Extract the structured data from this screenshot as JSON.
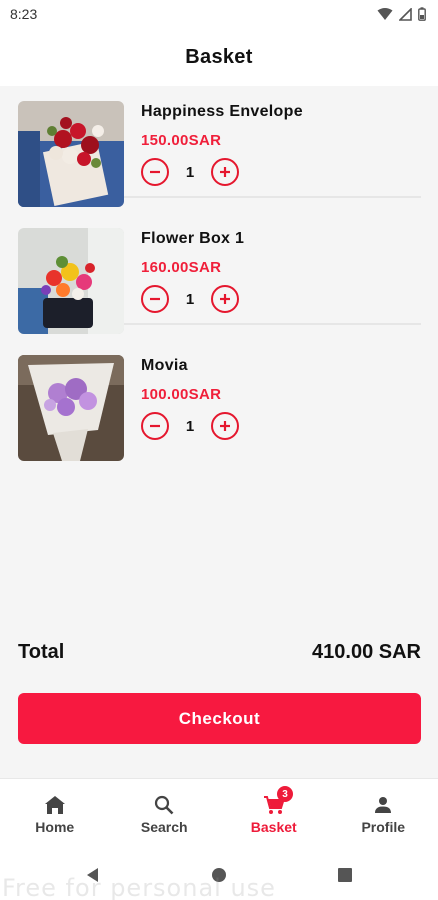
{
  "status_bar": {
    "time": "8:23",
    "icons": [
      "wifi-icon",
      "signal-icon",
      "battery-icon"
    ]
  },
  "header": {
    "title": "Basket"
  },
  "basket": {
    "items": [
      {
        "name": "Happiness Envelope",
        "price": "150.00SAR",
        "quantity": "1",
        "image": "red-white-roses-envelope"
      },
      {
        "name": "Flower Box 1",
        "price": "160.00SAR",
        "quantity": "1",
        "image": "colorful-flower-box"
      },
      {
        "name": "Movia",
        "price": "100.00SAR",
        "quantity": "1",
        "image": "purple-bouquet"
      }
    ]
  },
  "summary": {
    "total_label": "Total",
    "total_value": "410.00 SAR",
    "checkout_label": "Checkout"
  },
  "bottom_nav": {
    "items": [
      {
        "label": "Home",
        "icon": "home-icon"
      },
      {
        "label": "Search",
        "icon": "search-icon"
      },
      {
        "label": "Basket",
        "icon": "cart-icon",
        "badge": "3",
        "active": true
      },
      {
        "label": "Profile",
        "icon": "person-icon"
      }
    ]
  },
  "system_nav": [
    "back-icon",
    "home-circle-icon",
    "recents-icon"
  ],
  "watermark": "Free for personal use",
  "colors": {
    "accent": "#f71940",
    "price": "#f01f3a",
    "background": "#f5f5f5"
  }
}
